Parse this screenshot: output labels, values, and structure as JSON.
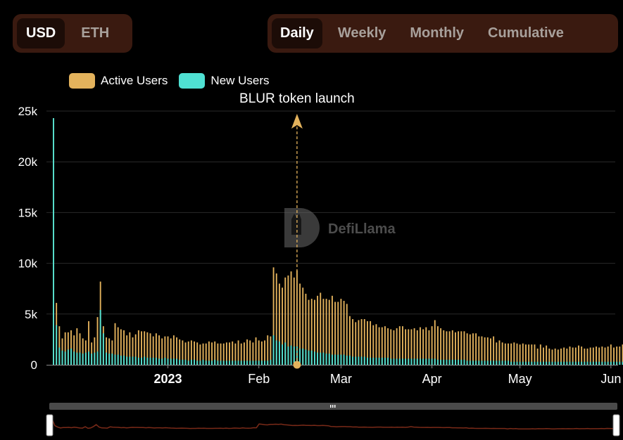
{
  "currency_toggle": {
    "options": [
      "USD",
      "ETH"
    ],
    "selected": "USD"
  },
  "period_toggle": {
    "options": [
      "Daily",
      "Weekly",
      "Monthly",
      "Cumulative"
    ],
    "selected": "Daily"
  },
  "colors": {
    "active_users": "#e3b25c",
    "new_users": "#4fe0d2",
    "toggle_bg": "#3a1a10",
    "toggle_active_bg": "#1c0c07",
    "brush_line": "#7a2a18"
  },
  "watermark": {
    "text": "DefiLlama",
    "icon": "llama-logo-icon"
  },
  "chart_data": {
    "type": "bar",
    "grid": true,
    "legend_position": "top-left",
    "ylim": [
      0,
      25000
    ],
    "yticks": [
      0,
      5000,
      10000,
      15000,
      20000,
      25000
    ],
    "ytick_labels": [
      "0",
      "5k",
      "10k",
      "15k",
      "20k",
      "25k"
    ],
    "x_start": "2022-11-23",
    "xlim": [
      "2022-11-23",
      "2023-06-02"
    ],
    "xticks": [
      {
        "date": "2023-01-01",
        "label": "2023"
      },
      {
        "date": "2023-02-01",
        "label": "Feb"
      },
      {
        "date": "2023-03-01",
        "label": "Mar"
      },
      {
        "date": "2023-04-01",
        "label": "Apr"
      },
      {
        "date": "2023-05-01",
        "label": "May"
      },
      {
        "date": "2023-06-01",
        "label": "Jun"
      }
    ],
    "annotation": {
      "text": "BLUR token launch",
      "date": "2023-02-14"
    },
    "series": [
      {
        "name": "Active Users",
        "values": [
          24300,
          6100,
          3800,
          2600,
          3200,
          3200,
          3400,
          2900,
          3600,
          3100,
          2600,
          2400,
          4300,
          2200,
          2700,
          4700,
          8200,
          3800,
          2700,
          2600,
          2400,
          4100,
          3700,
          3500,
          3400,
          2900,
          3200,
          2700,
          3000,
          3400,
          3300,
          3300,
          3200,
          3100,
          2800,
          3100,
          2900,
          2600,
          2800,
          2800,
          2600,
          2900,
          2700,
          2500,
          2400,
          2200,
          2300,
          2400,
          2300,
          2200,
          2000,
          2100,
          2100,
          2300,
          2200,
          2300,
          2100,
          2100,
          2100,
          2200,
          2200,
          2300,
          2100,
          2400,
          2100,
          2200,
          2500,
          2400,
          2200,
          2700,
          2400,
          2300,
          2400,
          2900,
          2800,
          9600,
          9000,
          8000,
          7600,
          8600,
          8800,
          9200,
          8600,
          9300,
          8000,
          7600,
          7000,
          6400,
          6500,
          6400,
          6800,
          7100,
          6500,
          6500,
          6400,
          6800,
          6200,
          6200,
          6500,
          6300,
          6000,
          4800,
          4500,
          4200,
          4400,
          4500,
          4500,
          4300,
          4300,
          3900,
          4000,
          3700,
          3700,
          3800,
          3600,
          3500,
          3400,
          3600,
          3800,
          3800,
          3500,
          3500,
          3500,
          3600,
          3400,
          3700,
          3500,
          3700,
          3400,
          3800,
          4400,
          3800,
          3600,
          3400,
          3300,
          3300,
          3400,
          3200,
          3300,
          3300,
          3300,
          3100,
          3000,
          3100,
          3100,
          2800,
          2800,
          2700,
          2700,
          2600,
          2800,
          2200,
          2400,
          2200,
          2100,
          2100,
          2100,
          2200,
          2100,
          2000,
          2100,
          2000,
          2000,
          2000,
          2000,
          1600,
          2000,
          1700,
          1900,
          1600,
          1500,
          1600,
          1500,
          1600,
          1700,
          1600,
          1800,
          1700,
          1700,
          1900,
          1800,
          1600,
          1600,
          1700,
          1700,
          1800,
          1700,
          1800,
          1700,
          1800,
          2000,
          1700,
          1800,
          1800,
          2000,
          1700,
          1800,
          1800,
          1800,
          2000,
          1800,
          2100,
          2000,
          1900,
          1800
        ]
      },
      {
        "name": "New Users",
        "values": [
          24300,
          3900,
          1700,
          1400,
          1300,
          1500,
          1600,
          1300,
          1200,
          1200,
          1100,
          1200,
          1300,
          1100,
          1200,
          1300,
          5400,
          3100,
          1200,
          1100,
          1100,
          1000,
          1000,
          900,
          900,
          800,
          800,
          800,
          800,
          700,
          700,
          800,
          700,
          700,
          700,
          700,
          600,
          600,
          700,
          600,
          600,
          600,
          600,
          500,
          500,
          500,
          400,
          500,
          500,
          400,
          400,
          500,
          400,
          400,
          400,
          500,
          400,
          400,
          400,
          400,
          400,
          400,
          400,
          400,
          400,
          400,
          400,
          400,
          400,
          400,
          400,
          400,
          400,
          400,
          500,
          2900,
          2400,
          2300,
          2000,
          2200,
          1800,
          1900,
          1800,
          1800,
          1600,
          1600,
          1500,
          1400,
          1400,
          1300,
          1200,
          1200,
          1200,
          1100,
          1100,
          1000,
          1000,
          1000,
          1000,
          1000,
          900,
          900,
          800,
          800,
          800,
          800,
          800,
          700,
          700,
          700,
          700,
          700,
          700,
          700,
          700,
          600,
          600,
          600,
          600,
          600,
          600,
          600,
          600,
          600,
          600,
          600,
          600,
          600,
          600,
          600,
          600,
          500,
          500,
          500,
          500,
          500,
          500,
          500,
          500,
          500,
          500,
          400,
          400,
          400,
          400,
          400,
          400,
          400,
          400,
          400,
          400,
          400,
          400,
          400,
          400,
          400,
          300,
          300,
          300,
          300,
          300,
          300,
          300,
          300,
          300,
          300,
          300,
          300,
          300,
          300,
          300,
          300,
          300,
          300,
          300,
          300,
          300,
          300,
          300,
          300,
          300,
          300,
          300,
          300,
          300,
          300,
          300,
          300,
          300,
          300,
          300,
          300,
          300,
          300,
          300,
          300,
          300,
          300,
          300,
          300,
          300,
          300,
          300,
          300,
          300,
          300,
          300
        ]
      }
    ]
  }
}
